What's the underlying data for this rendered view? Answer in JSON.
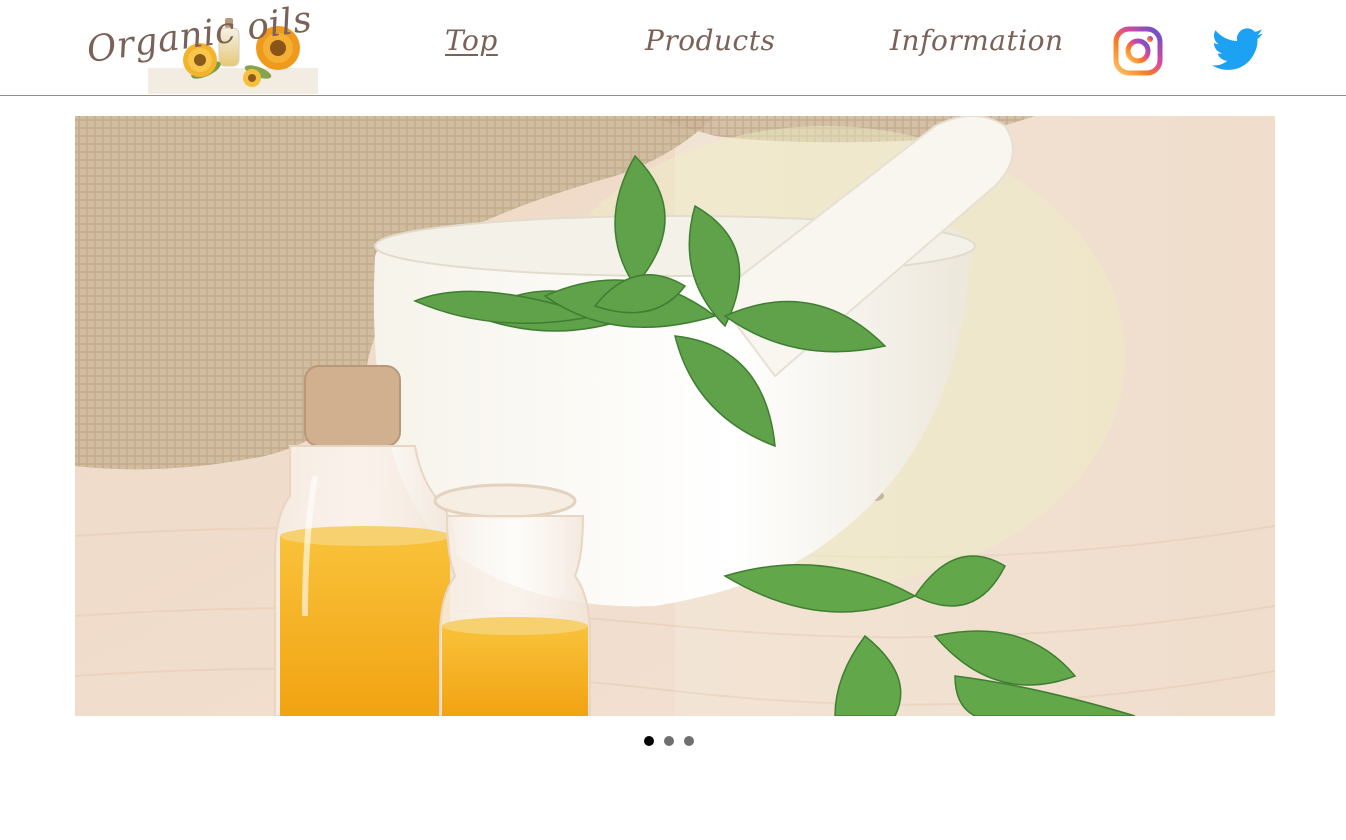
{
  "header": {
    "logo_text": "Organic oils",
    "nav": {
      "top": "Top",
      "products": "Products",
      "information": "Information"
    },
    "social": [
      {
        "name": "Instagram",
        "icon": "instagram-icon"
      },
      {
        "name": "Twitter",
        "icon": "twitter-icon"
      }
    ]
  },
  "slider": {
    "image": "essential-oil-bottles-mortar-basil-photo",
    "active_slide": 1,
    "total_slides": 3
  },
  "colors": {
    "nav_text": "#7a6258",
    "header_border": "#9b8b80",
    "twitter_blue": "#1da1f2",
    "instagram_gradient": [
      "#fdc468",
      "#df4996",
      "#5b51d8"
    ]
  }
}
